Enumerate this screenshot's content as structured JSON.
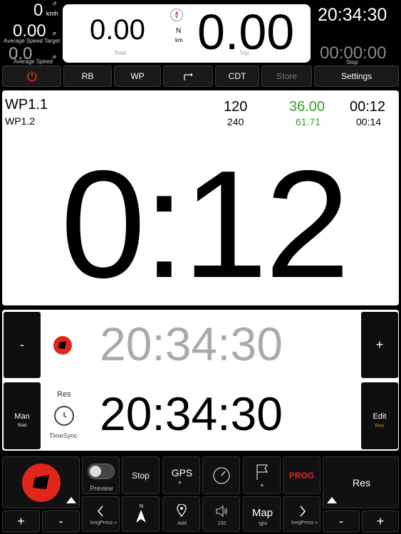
{
  "speed": {
    "current_value": "0",
    "current_unit": "kmh",
    "target_value": "0.00",
    "target_caption": "Average Speed Target",
    "average_value": "0.0",
    "average_caption": "Average Speed"
  },
  "odometer": {
    "total_value": "0.00",
    "total_caption": "Total",
    "compass_dir": "N",
    "unit": "km",
    "trip_value": "0.00",
    "trip_caption": "Trip"
  },
  "clock": {
    "time": "20:34:30",
    "stop_time": "00:00:00",
    "stop_caption": "Stop"
  },
  "menu": {
    "rb": "RB",
    "wp": "WP",
    "cdt": "CDT",
    "store": "Store",
    "settings": "Settings"
  },
  "waypoint": {
    "current": "WP1.1",
    "next": "WP1.2",
    "dist_current": "120",
    "dist_next": "240",
    "speed_current": "36.00",
    "speed_next": "61.71",
    "time_current": "00:12",
    "time_next": "00:14",
    "countdown": "0:12"
  },
  "times": {
    "minus": "-",
    "plus": "+",
    "target_time": "20:34:30",
    "current_time": "20:34:30",
    "man_label": "Man",
    "man_sub": "Start",
    "res_label": "Res",
    "timesync_label": "TimeSync",
    "edit_label": "Edit",
    "edit_sub": "Res"
  },
  "controls": {
    "preview": "Preview",
    "stop": "Stop",
    "gps": "GPS",
    "prog": "PROG",
    "res": "Res",
    "plus": "+",
    "minus": "-",
    "long_press_back": "longPress",
    "long_press_fwd": "longPress",
    "north": "N",
    "add": "Add",
    "volume": "100",
    "map": "Map",
    "map_sub": "-gpx"
  },
  "colors": {
    "accent_red": "#e0261b",
    "green": "#3a9b2a",
    "orange": "#e08a1e"
  }
}
